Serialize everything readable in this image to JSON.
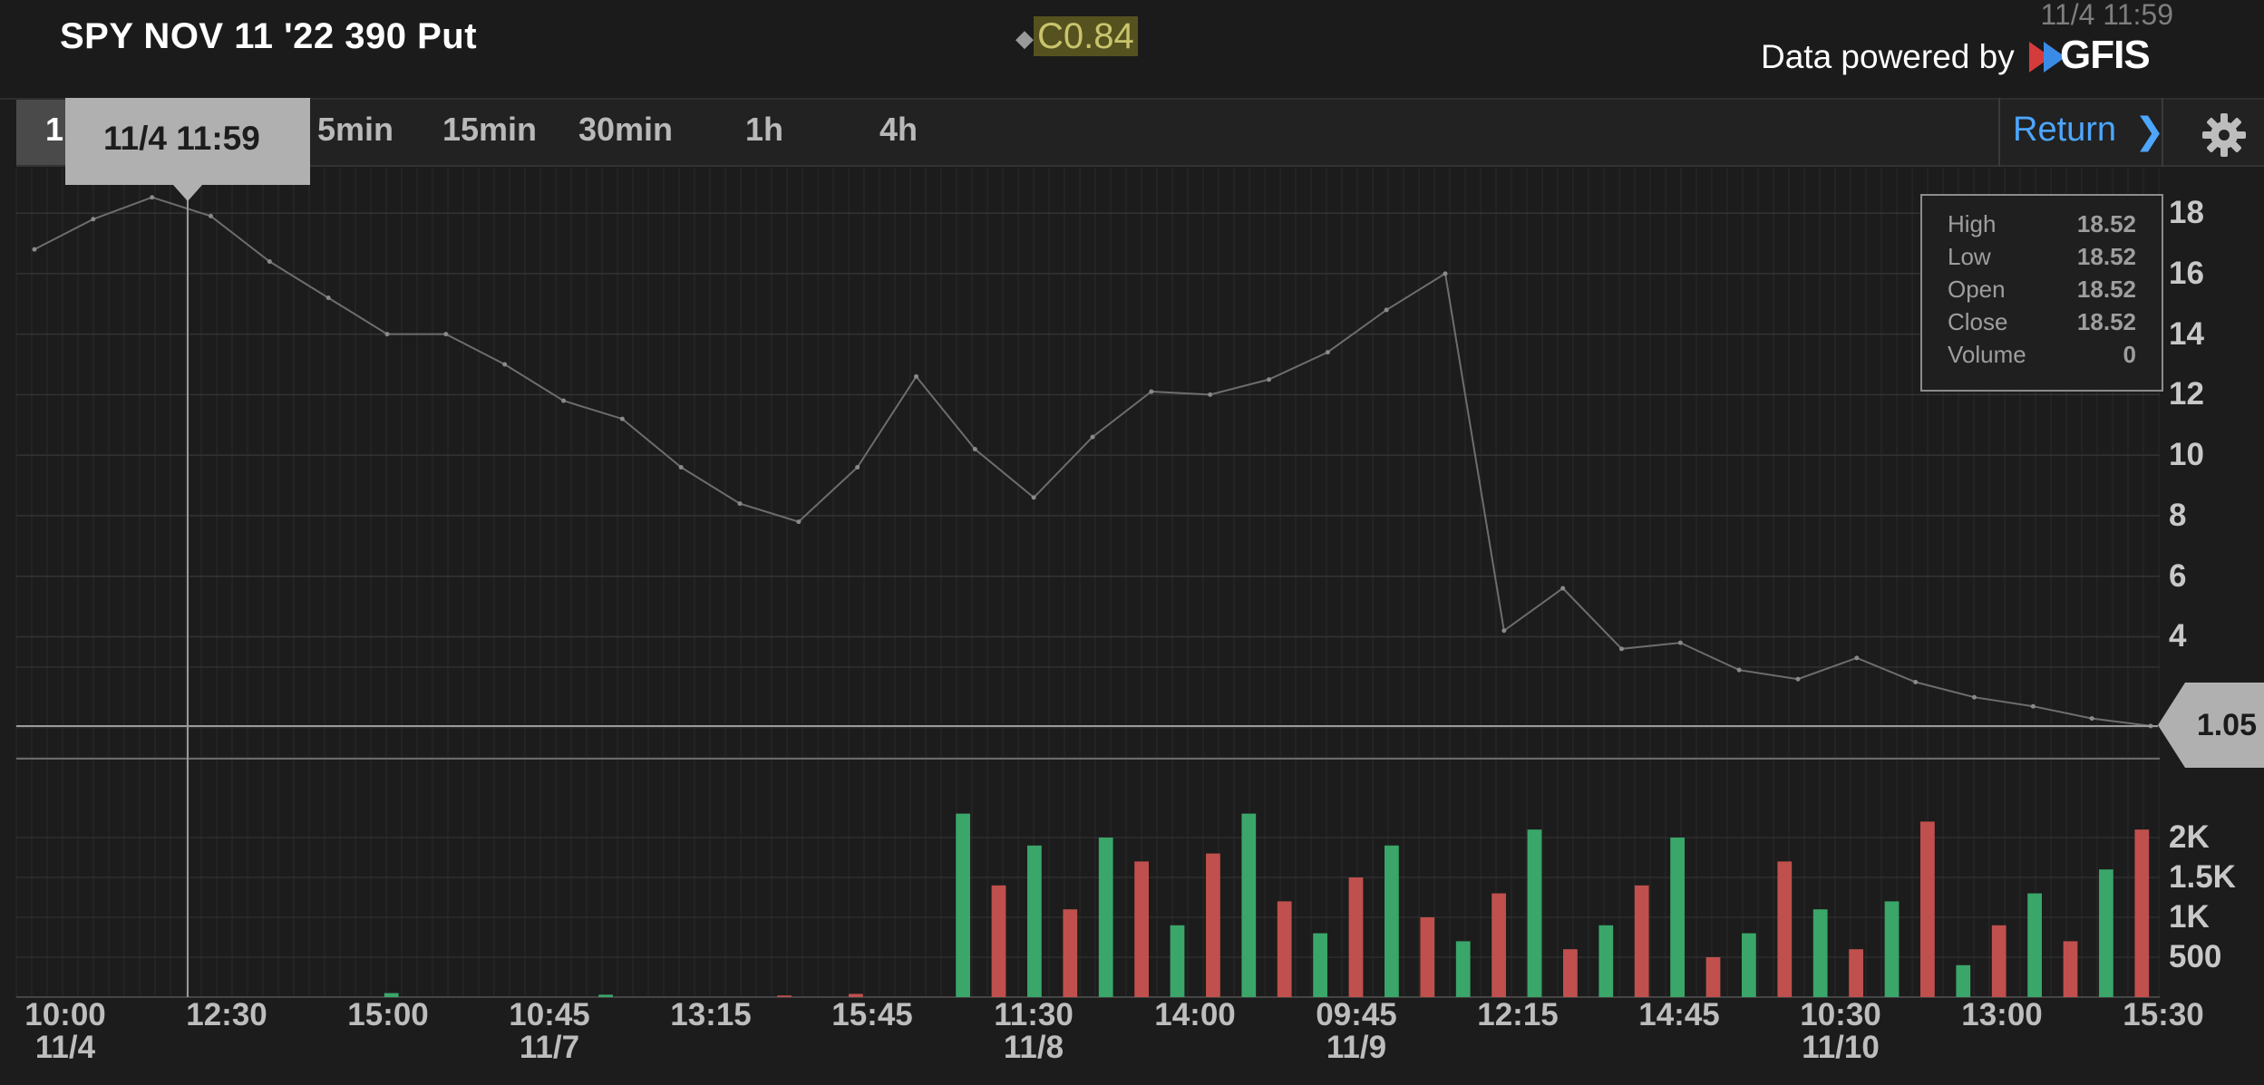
{
  "header": {
    "title": "SPY NOV 11 '22 390 Put",
    "quote_marker": "◆",
    "quote_value": "C0.84",
    "timestamp": "11/4 11:59",
    "powered_by": "Data powered by",
    "logo_text": "GFIS"
  },
  "timeframes": {
    "active": "1",
    "items": [
      "5min",
      "15min",
      "30min",
      "1h",
      "4h"
    ],
    "return_label": "Return"
  },
  "crosshair": {
    "label": "11/4 11:59"
  },
  "ohlc": {
    "rows": [
      {
        "label": "High",
        "value": "18.52"
      },
      {
        "label": "Low",
        "value": "18.52"
      },
      {
        "label": "Open",
        "value": "18.52"
      },
      {
        "label": "Close",
        "value": "18.52"
      },
      {
        "label": "Volume",
        "value": "0"
      }
    ]
  },
  "chart_data": {
    "type": "line",
    "title": "",
    "last_price": 1.05,
    "price_axis": {
      "ticks": [
        "18",
        "16",
        "14",
        "12",
        "10",
        "8",
        "6",
        "4"
      ],
      "ylim": [
        0,
        19.5
      ]
    },
    "volume_axis": {
      "ticks": [
        "2K",
        "1.5K",
        "1K",
        "500"
      ],
      "ylim": [
        0,
        2500
      ]
    },
    "x_ticks": [
      {
        "time": "10:00",
        "date": "11/4"
      },
      {
        "time": "12:30",
        "date": ""
      },
      {
        "time": "15:00",
        "date": ""
      },
      {
        "time": "10:45",
        "date": "11/7"
      },
      {
        "time": "13:15",
        "date": ""
      },
      {
        "time": "15:45",
        "date": ""
      },
      {
        "time": "11:30",
        "date": "11/8"
      },
      {
        "time": "14:00",
        "date": ""
      },
      {
        "time": "09:45",
        "date": "11/9"
      },
      {
        "time": "12:15",
        "date": ""
      },
      {
        "time": "14:45",
        "date": ""
      },
      {
        "time": "10:30",
        "date": "11/10"
      },
      {
        "time": "13:00",
        "date": ""
      },
      {
        "time": "15:30",
        "date": ""
      }
    ],
    "series": [
      {
        "values": [
          16.8,
          17.8,
          18.52,
          17.9,
          16.4,
          15.2,
          14.0,
          14.0,
          13.0,
          11.8,
          11.2,
          9.6,
          8.4,
          7.8,
          9.6,
          12.6,
          10.2,
          8.6,
          10.6,
          12.1,
          12.0,
          12.5,
          13.4,
          14.8,
          16.0,
          4.2,
          5.6,
          3.6,
          3.8,
          2.9,
          2.6,
          3.3,
          2.5,
          2.0,
          1.7,
          1.3,
          1.05
        ]
      }
    ],
    "volume": [
      0,
      0,
      0,
      0,
      0,
      0,
      0,
      0,
      0,
      0,
      50,
      0,
      0,
      0,
      0,
      0,
      30,
      0,
      0,
      0,
      0,
      20,
      0,
      40,
      0,
      0,
      2300,
      1400,
      1900,
      1100,
      2000,
      1700,
      900,
      1800,
      2300,
      1200,
      800,
      1500,
      1900,
      1000,
      700,
      1300,
      2100,
      600,
      900,
      1400,
      2000,
      500,
      800,
      1700,
      1100,
      600,
      1200,
      2200,
      400,
      900,
      1300,
      700,
      1600,
      2100
    ]
  }
}
